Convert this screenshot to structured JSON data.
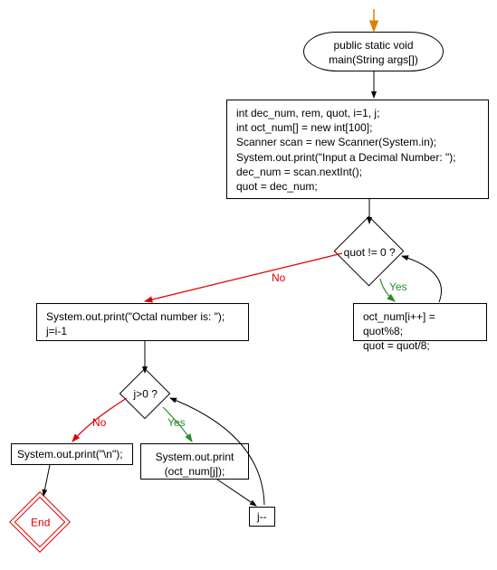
{
  "nodes": {
    "start": {
      "line1": "public static void",
      "line2": "main(String args[])"
    },
    "init": {
      "l1": "int dec_num, rem, quot, i=1, j;",
      "l2": "int oct_num[] = new int[100];",
      "l3": "Scanner scan = new Scanner(System.in);",
      "l4": "System.out.print(\"Input a Decimal Number: \");",
      "l5": "dec_num = scan.nextInt();",
      "l6": "quot = dec_num;"
    },
    "cond1": "quot != 0 ?",
    "loop1": {
      "l1": "oct_num[i++] = quot%8;",
      "l2": "quot = quot/8;"
    },
    "print_header": {
      "l1": "System.out.print(\"Octal number is: \");",
      "l2": "j=i-1"
    },
    "cond2": "j>0 ?",
    "print_digit": {
      "l1": "System.out.print",
      "l2": "(oct_num[j]);"
    },
    "decr": "j--",
    "print_nl": "System.out.print(\"\\n\");",
    "end": "End"
  },
  "labels": {
    "yes1": "Yes",
    "no1": "No",
    "yes2": "Yes",
    "no2": "No"
  },
  "chart_data": {
    "type": "flowchart",
    "nodes": [
      {
        "id": "start",
        "kind": "terminator",
        "text": "public static void main(String args[])"
      },
      {
        "id": "init",
        "kind": "process",
        "text": "int dec_num, rem, quot, i=1, j;\nint oct_num[] = new int[100];\nScanner scan = new Scanner(System.in);\nSystem.out.print(\"Input a Decimal Number: \");\ndec_num = scan.nextInt();\nquot = dec_num;"
      },
      {
        "id": "cond1",
        "kind": "decision",
        "text": "quot != 0 ?"
      },
      {
        "id": "loop1",
        "kind": "process",
        "text": "oct_num[i++] = quot%8;\nquot = quot/8;"
      },
      {
        "id": "print_header",
        "kind": "process",
        "text": "System.out.print(\"Octal number is: \");\nj=i-1"
      },
      {
        "id": "cond2",
        "kind": "decision",
        "text": "j>0 ?"
      },
      {
        "id": "print_digit",
        "kind": "process",
        "text": "System.out.print(oct_num[j]);"
      },
      {
        "id": "decr",
        "kind": "process",
        "text": "j--"
      },
      {
        "id": "print_nl",
        "kind": "process",
        "text": "System.out.print(\"\\n\");"
      },
      {
        "id": "end",
        "kind": "terminator",
        "text": "End"
      }
    ],
    "edges": [
      {
        "from": "entry",
        "to": "start"
      },
      {
        "from": "start",
        "to": "init"
      },
      {
        "from": "init",
        "to": "cond1"
      },
      {
        "from": "cond1",
        "to": "loop1",
        "label": "Yes"
      },
      {
        "from": "loop1",
        "to": "cond1"
      },
      {
        "from": "cond1",
        "to": "print_header",
        "label": "No"
      },
      {
        "from": "print_header",
        "to": "cond2"
      },
      {
        "from": "cond2",
        "to": "print_digit",
        "label": "Yes"
      },
      {
        "from": "print_digit",
        "to": "decr"
      },
      {
        "from": "decr",
        "to": "cond2"
      },
      {
        "from": "cond2",
        "to": "print_nl",
        "label": "No"
      },
      {
        "from": "print_nl",
        "to": "end"
      }
    ]
  }
}
